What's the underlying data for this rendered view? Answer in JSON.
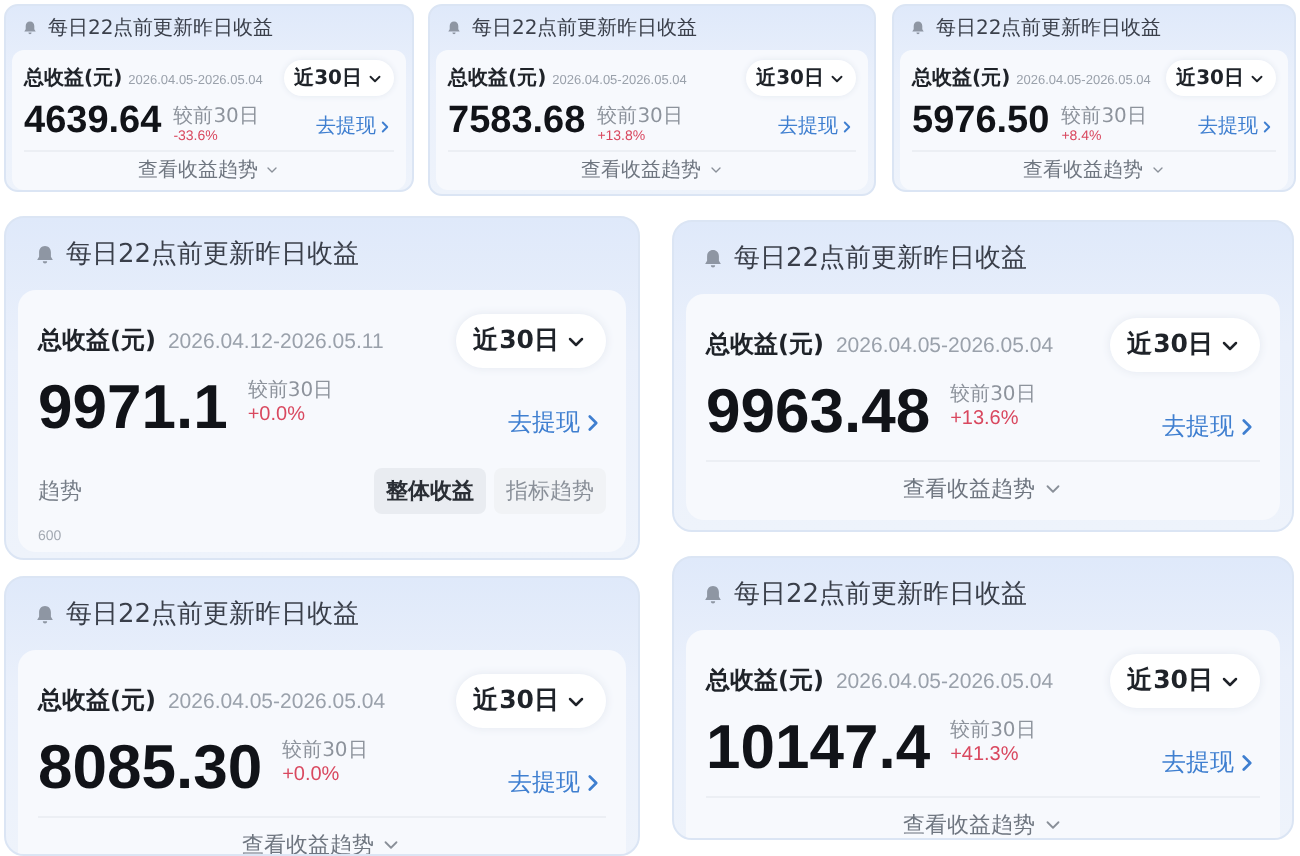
{
  "cards": [
    {
      "title": "每日22点前更新昨日收益",
      "label": "总收益(元)",
      "date_range": "2026.04.05-2026.05.04",
      "period": "近30日",
      "amount": "4639.64",
      "compare_label": "较前30日",
      "change": "-33.6%",
      "withdraw": "去提现",
      "footer": {
        "kind": "toggle",
        "text": "查看收益趋势"
      }
    },
    {
      "title": "每日22点前更新昨日收益",
      "label": "总收益(元)",
      "date_range": "2026.04.05-2026.05.04",
      "period": "近30日",
      "amount": "7583.68",
      "compare_label": "较前30日",
      "change": "+13.8%",
      "withdraw": "去提现",
      "footer": {
        "kind": "toggle",
        "text": "查看收益趋势"
      }
    },
    {
      "title": "每日22点前更新昨日收益",
      "label": "总收益(元)",
      "date_range": "2026.04.05-2026.05.04",
      "period": "近30日",
      "amount": "5976.50",
      "compare_label": "较前30日",
      "change": "+8.4%",
      "withdraw": "去提现",
      "footer": {
        "kind": "toggle",
        "text": "查看收益趋势"
      }
    },
    {
      "title": "每日22点前更新昨日收益",
      "label": "总收益(元)",
      "date_range": "2026.04.12-2026.05.11",
      "period": "近30日",
      "amount": "9971.1",
      "compare_label": "较前30日",
      "change": "+0.0%",
      "withdraw": "去提现",
      "footer": {
        "kind": "trend",
        "label": "趋势",
        "tabs": [
          {
            "label": "整体收益",
            "selected": true
          },
          {
            "label": "指标趋势",
            "selected": false
          }
        ],
        "axis_label": "600"
      }
    },
    {
      "title": "每日22点前更新昨日收益",
      "label": "总收益(元)",
      "date_range": "2026.04.05-2026.05.04",
      "period": "近30日",
      "amount": "9963.48",
      "compare_label": "较前30日",
      "change": "+13.6%",
      "withdraw": "去提现",
      "footer": {
        "kind": "toggle",
        "text": "查看收益趋势"
      }
    },
    {
      "title": "每日22点前更新昨日收益",
      "label": "总收益(元)",
      "date_range": "2026.04.05-2026.05.04",
      "period": "近30日",
      "amount": "8085.30",
      "compare_label": "较前30日",
      "change": "+0.0%",
      "withdraw": "去提现",
      "footer": {
        "kind": "toggle",
        "text": "查看收益趋势"
      }
    },
    {
      "title": "每日22点前更新昨日收益",
      "label": "总收益(元)",
      "date_range": "2026.04.05-2026.05.04",
      "period": "近30日",
      "amount": "10147.4",
      "compare_label": "较前30日",
      "change": "+41.3%",
      "withdraw": "去提现",
      "footer": {
        "kind": "toggle",
        "text": "查看收益趋势"
      }
    }
  ]
}
